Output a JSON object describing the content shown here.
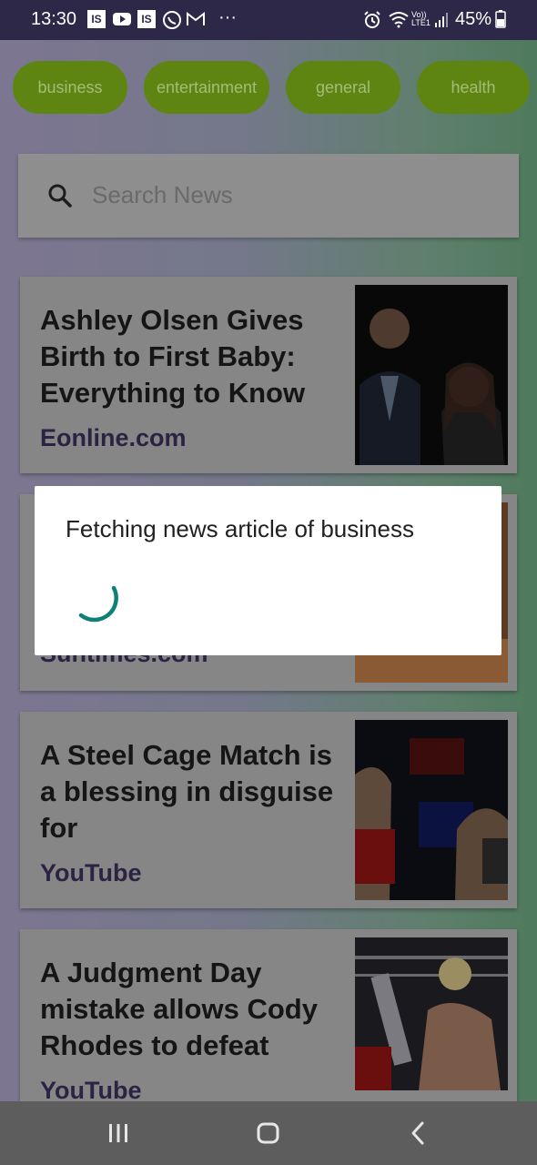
{
  "status_bar": {
    "time": "13:30",
    "icons": [
      "is-app-icon",
      "youtube-icon",
      "is-app-icon",
      "whatsapp-icon",
      "gmail-icon",
      "more-dots-icon",
      "alarm-icon",
      "wifi-icon",
      "volte-icon",
      "signal-icon",
      "battery-icon"
    ],
    "is_label": "IS",
    "more": "···",
    "volte": "Vo)) LTE1",
    "battery": "45%"
  },
  "categories": [
    "business",
    "entertainment",
    "general",
    "health"
  ],
  "search": {
    "placeholder": "Search News"
  },
  "articles": [
    {
      "title": "Ashley Olsen Gives Birth to First Baby: Everything to Know",
      "source": "Eonline.com"
    },
    {
      "title": "",
      "source": "Suntimes.com"
    },
    {
      "title": "A Steel Cage Match is a blessing in disguise for",
      "source": "YouTube"
    },
    {
      "title": "A Judgment Day mistake allows Cody Rhodes to defeat",
      "source": "YouTube"
    }
  ],
  "dialog": {
    "message": "Fetching news article of business"
  },
  "colors": {
    "status_bar": "#2d2748",
    "chip": "#5e8512",
    "spinner": "#0f8078",
    "source_text": "#2c2242"
  }
}
